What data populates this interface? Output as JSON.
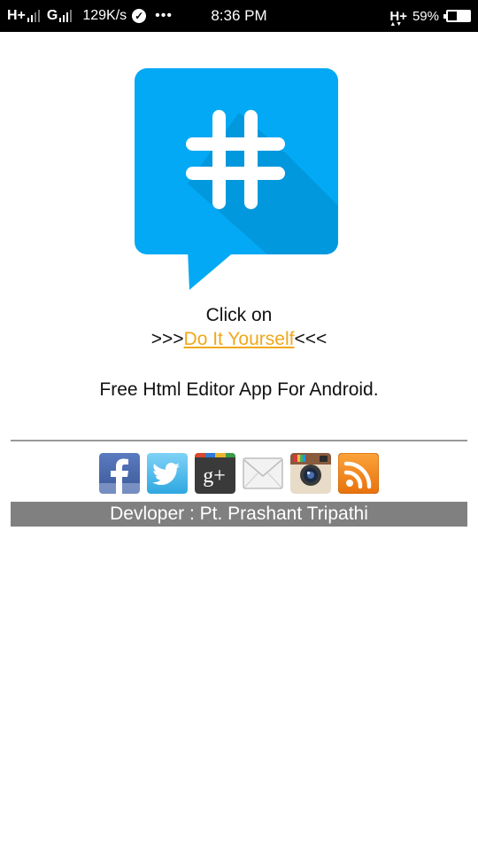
{
  "status_bar": {
    "signal_1": "H+",
    "signal_2": "G",
    "speed": "129K/s",
    "more": "•••",
    "time": "8:36 PM",
    "data_type": "H+",
    "battery": "59%",
    "battery_level": 0.59
  },
  "content": {
    "click_text": "Click on",
    "link_prefix": ">>>",
    "link_text": "Do It Yourself",
    "link_suffix": "<<<",
    "tagline": "Free Html Editor App For Android."
  },
  "social_icons": [
    "facebook-icon",
    "twitter-icon",
    "google-plus-icon",
    "email-icon",
    "instagram-icon",
    "rss-icon"
  ],
  "footer": {
    "developer": "Devloper : Pt. Prashant Tripathi"
  },
  "colors": {
    "logo_blue": "#03a9f4",
    "link": "#f0a81a",
    "footer_bg": "#808080"
  }
}
